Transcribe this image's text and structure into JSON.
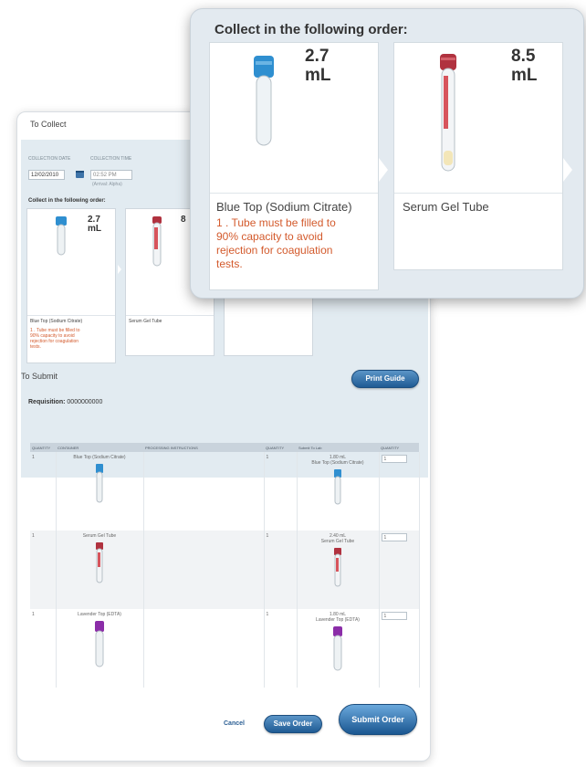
{
  "zoom": {
    "title": "Collect in the following order:",
    "cards": [
      {
        "volume": "2.7\nmL",
        "name": "Blue Top (Sodium Citrate)",
        "note": "1 . Tube must be filled to\n90% capacity to avoid\nrejection for coagulation\ntests."
      },
      {
        "volume": "8.5\nmL",
        "name": "Serum Gel Tube",
        "note": ""
      }
    ]
  },
  "collect": {
    "title": "To Collect",
    "date_label": "COLLECTION DATE",
    "date_value": "12/02/2010",
    "time_label": "COLLECTION TIME",
    "time_value": "02:52 PM",
    "timezone": "(Arrival: Alpha)",
    "order_heading": "Collect in the following order:",
    "mini_cards": [
      {
        "volume": "2.7\nmL",
        "name": "Blue Top (Sodium Citrate)",
        "note": "1 . Tube must be filled to\n90% capacity to avoid\nrejection for coagulation\ntests."
      },
      {
        "volume": "8",
        "name": "Serum Gel Tube",
        "note": ""
      },
      {
        "volume": "",
        "name": "",
        "note": ""
      }
    ]
  },
  "submit": {
    "title": "To Submit",
    "print_guide": "Print Guide",
    "requisition_label": "Requisition:",
    "requisition_value": "0000000000",
    "columns": [
      "QUANTITY",
      "CONTAINER",
      "PROCESSING INSTRUCTIONS",
      "QUANTITY",
      "Submit To Lab",
      "QUANTITY"
    ],
    "rows": [
      {
        "qty": "1",
        "container": "Blue Top (Sodium Citrate)",
        "instructions": "",
        "qty2": "1",
        "submit_volume": "1.80 mL",
        "submit_container": "Blue Top (Sodium Citrate)",
        "input_value": "1"
      },
      {
        "qty": "1",
        "container": "Serum Gel Tube",
        "instructions": "",
        "qty2": "1",
        "submit_volume": "2.40 mL",
        "submit_container": "Serum Gel Tube",
        "input_value": "1"
      },
      {
        "qty": "1",
        "container": "Lavender Top (EDTA)",
        "instructions": "",
        "qty2": "1",
        "submit_volume": "1.80 mL",
        "submit_container": "Lavender Top (EDTA)",
        "input_value": "1"
      }
    ],
    "cancel": "Cancel",
    "save_order": "Save Order",
    "submit_order": "Submit Order"
  },
  "colors": {
    "blue_cap": "#2f8fd0",
    "red_cap": "#b0323f",
    "purple_cap": "#8b2da8",
    "note": "#d35a2c",
    "button": "#2a66a3"
  }
}
